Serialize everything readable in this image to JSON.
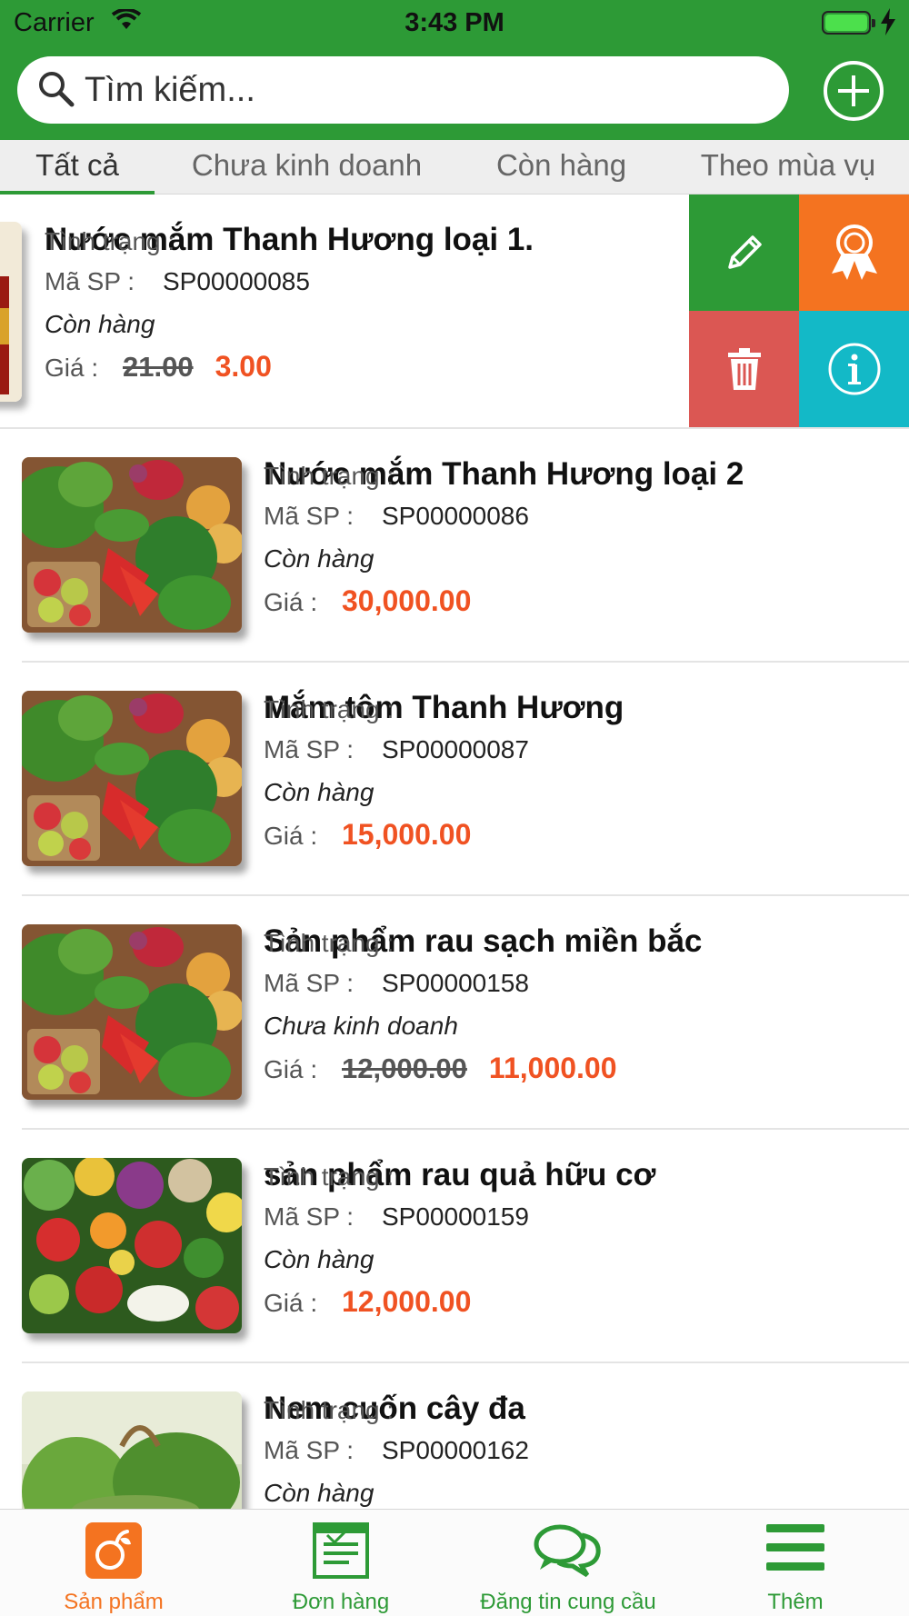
{
  "status_bar": {
    "carrier": "Carrier",
    "time": "3:43 PM"
  },
  "search": {
    "placeholder": "Tìm kiếm...",
    "value": ""
  },
  "tabs": [
    {
      "label": "Tất cả",
      "active": true
    },
    {
      "label": "Chưa kinh doanh",
      "active": false
    },
    {
      "label": "Còn hàng",
      "active": false
    },
    {
      "label": "Theo mùa vụ",
      "active": false
    }
  ],
  "labels": {
    "code": "Mã SP :",
    "status": "Tình trạng :",
    "price": "Giá :"
  },
  "products": [
    {
      "name": "Nước mắm Thanh Hương loại 1.",
      "code": "SP00000085",
      "status": "Còn hàng",
      "old_price": "21.00",
      "price": "3.00",
      "image": "fish-sauce-bottle"
    },
    {
      "name": "Nước mắm Thanh Hương loại 2",
      "code": "SP00000086",
      "status": "Còn hàng",
      "old_price": "",
      "price": "30,000.00",
      "image": "vegetables-basket"
    },
    {
      "name": "Mắm tôm Thanh Hương",
      "code": "SP00000087",
      "status": "Còn hàng",
      "old_price": "",
      "price": "15,000.00",
      "image": "vegetables-basket"
    },
    {
      "name": "Sản phẩm rau sạch miền bắc",
      "code": "SP00000158",
      "status": "Chưa kinh doanh",
      "old_price": "12,000.00",
      "price": "11,000.00",
      "image": "vegetables-basket"
    },
    {
      "name": "sản phẩm rau quả hữu cơ",
      "code": "SP00000159",
      "status": "Còn hàng",
      "old_price": "",
      "price": "12,000.00",
      "image": "mixed-vegetables"
    },
    {
      "name": "Nem cuốn cây đa",
      "code": "SP00000162",
      "status": "Còn hàng",
      "old_price": "",
      "price": "",
      "image": "garden-basket"
    }
  ],
  "swipe_actions": [
    "pencil-icon",
    "award-ribbon-icon",
    "trash-icon",
    "info-icon"
  ],
  "bottom_tabs": [
    {
      "label": "Sản phẩm",
      "icon": "product-icon",
      "selected": true
    },
    {
      "label": "Đơn hàng",
      "icon": "order-list-icon",
      "selected": false
    },
    {
      "label": "Đăng tin cung cầu",
      "icon": "chat-bubbles-icon",
      "selected": false
    },
    {
      "label": "Thêm",
      "icon": "menu-icon",
      "selected": false
    }
  ],
  "colors": {
    "brand_green": "#2d9a36",
    "orange": "#f47320",
    "price_red": "#f05222",
    "delete_red": "#db5753",
    "info_cyan": "#13b9c7"
  }
}
